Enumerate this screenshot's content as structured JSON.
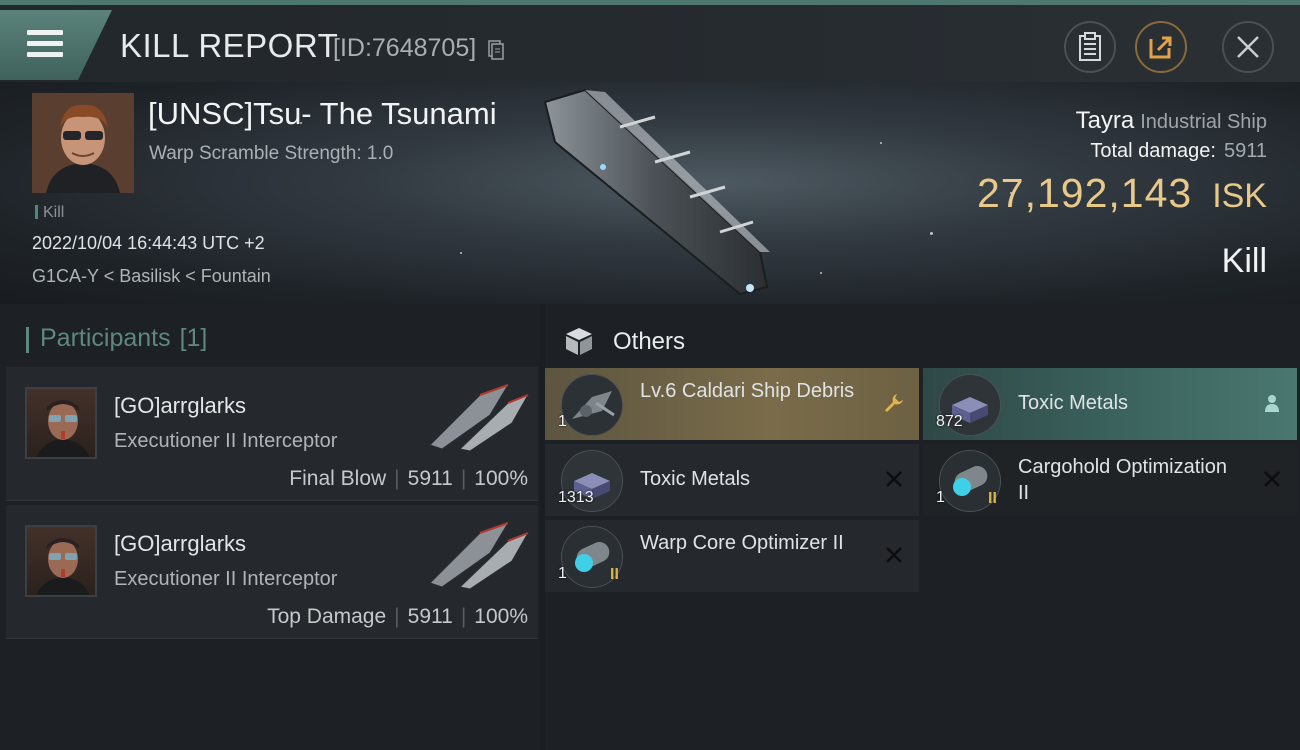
{
  "header": {
    "title": "KILL REPORT",
    "report_id": "[ID:7648705]",
    "buttons": [
      "clipboard-icon",
      "share-icon",
      "close-icon"
    ]
  },
  "victim": {
    "name": "[UNSC]Tsu- The Tsunami",
    "warp_scramble": "Warp Scramble Strength: 1.0",
    "kill_tag": "Kill",
    "datetime": "2022/10/04 16:44:43 UTC +2",
    "location": "G1CA-Y < Basilisk < Fountain",
    "ship_name": "Tayra",
    "ship_class": "Industrial Ship",
    "total_damage_label": "Total damage:",
    "total_damage": "5911",
    "isk_value": "27,192,143",
    "isk_currency": "ISK",
    "result": "Kill"
  },
  "participants": {
    "title": "Participants",
    "count": "[1]",
    "rows": [
      {
        "name": "[GO]arrglarks",
        "ship": "Executioner II Interceptor",
        "role": "Final Blow",
        "damage": "5911",
        "percent": "100%"
      },
      {
        "name": "[GO]arrglarks",
        "ship": "Executioner II Interceptor",
        "role": "Top Damage",
        "damage": "5911",
        "percent": "100%"
      }
    ]
  },
  "others": {
    "title": "Others",
    "items": [
      {
        "name": "Lv.6 Caldari Ship Debris",
        "qty": "1",
        "meta": "",
        "state": "gold",
        "action_icon": "wrench-icon"
      },
      {
        "name": "Toxic Metals",
        "qty": "872",
        "meta": "",
        "state": "teal",
        "action_icon": "person-icon"
      },
      {
        "name": "Toxic Metals",
        "qty": "1313",
        "meta": "",
        "state": "default",
        "action_icon": "x-icon"
      },
      {
        "name": "Cargohold Optimization II",
        "qty": "1",
        "meta": "II",
        "state": "default",
        "action_icon": "x-icon"
      },
      {
        "name": "Warp Core Optimizer II",
        "qty": "1",
        "meta": "II",
        "state": "default",
        "action_icon": "x-icon"
      }
    ]
  },
  "colors": {
    "accent_teal": "#5e8780",
    "isk_gold": "#e8c98a",
    "meta_gold": "#d9b64a"
  }
}
